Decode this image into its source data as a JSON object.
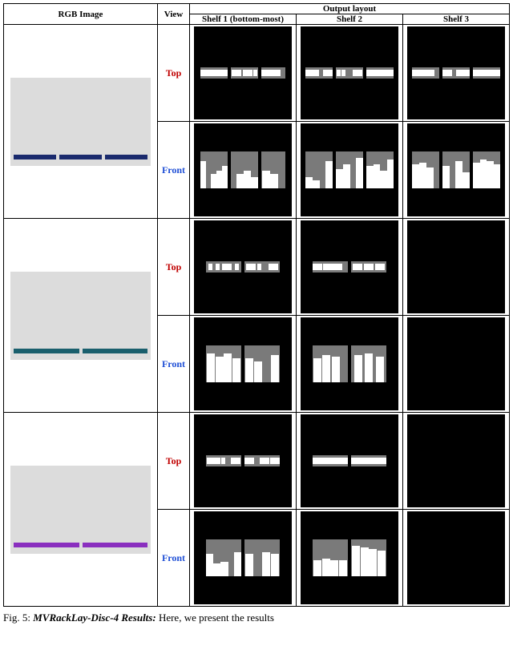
{
  "header": {
    "rgb": "RGB Image",
    "view": "View",
    "outputs_group": "Output layout",
    "shelf1": "Shelf 1 (bottom-most)",
    "shelf2": "Shelf 2",
    "shelf3": "Shelf 3"
  },
  "views": {
    "top": "Top",
    "front": "Front"
  },
  "caption_prefix": "Fig. 5:",
  "caption_title": "MVRackLay-Disc-4 Results:",
  "caption_rest": "Here, we present the results",
  "rows": [
    {
      "rgb": {
        "racks": 3,
        "tiers": 4,
        "color": "navy"
      },
      "shelves": {
        "1": {
          "top": {
            "bays": [
              {
                "w": 34,
                "items": [
                  "s",
                  "s",
                  "w",
                  "w"
                ]
              },
              {
                "w": 34,
                "items": [
                  "w",
                  "w",
                  "s"
                ]
              },
              {
                "w": 30,
                "items": [
                  "w",
                  "w",
                  "sp"
                ]
              }
            ]
          },
          "front": {
            "bays": [
              {
                "w": 34,
                "items": [
                  {
                    "h": 34
                  },
                  {
                    "sp": 1
                  },
                  {
                    "h": 18
                  },
                  {
                    "h": 22
                  },
                  {
                    "h": 28
                  }
                ]
              },
              {
                "w": 34,
                "items": [
                  {
                    "sp": 1
                  },
                  {
                    "h": 18
                  },
                  {
                    "h": 22
                  },
                  {
                    "h": 14
                  }
                ]
              },
              {
                "w": 30,
                "items": [
                  {
                    "h": 22
                  },
                  {
                    "h": 18
                  },
                  {
                    "sp": 1
                  }
                ]
              }
            ]
          }
        },
        "2": {
          "top": {
            "bays": [
              {
                "w": 34,
                "items": [
                  "w",
                  "s",
                  "sp",
                  "w"
                ]
              },
              {
                "w": 34,
                "items": [
                  "s",
                  "s",
                  "sp",
                  "w"
                ]
              },
              {
                "w": 34,
                "items": [
                  "w",
                  "w",
                  "s",
                  "w"
                ]
              }
            ]
          },
          "front": {
            "bays": [
              {
                "w": 34,
                "items": [
                  {
                    "h": 14
                  },
                  {
                    "h": 10
                  },
                  {
                    "sp": 1
                  },
                  {
                    "h": 34
                  }
                ]
              },
              {
                "w": 34,
                "items": [
                  {
                    "h": 24
                  },
                  {
                    "h": 30
                  },
                  {
                    "sp": 1
                  },
                  {
                    "h": 38
                  }
                ]
              },
              {
                "w": 34,
                "items": [
                  {
                    "h": 28
                  },
                  {
                    "h": 30
                  },
                  {
                    "h": 22
                  },
                  {
                    "h": 36
                  }
                ]
              }
            ]
          }
        },
        "3": {
          "top": {
            "bays": [
              {
                "w": 34,
                "items": [
                  "w",
                  "w",
                  "s",
                  "sp"
                ]
              },
              {
                "w": 34,
                "items": [
                  "w",
                  "sp",
                  "w",
                  "s"
                ]
              },
              {
                "w": 34,
                "items": [
                  "w",
                  "w",
                  "w",
                  "w"
                ]
              }
            ]
          },
          "front": {
            "bays": [
              {
                "w": 34,
                "items": [
                  {
                    "h": 30
                  },
                  {
                    "h": 32
                  },
                  {
                    "h": 26
                  },
                  {
                    "sp": 1
                  }
                ]
              },
              {
                "w": 34,
                "items": [
                  {
                    "h": 28
                  },
                  {
                    "sp": 1
                  },
                  {
                    "h": 34
                  },
                  {
                    "h": 20
                  }
                ]
              },
              {
                "w": 34,
                "items": [
                  {
                    "h": 32
                  },
                  {
                    "h": 36
                  },
                  {
                    "h": 34
                  },
                  {
                    "h": 30
                  }
                ]
              }
            ]
          }
        }
      }
    },
    {
      "rgb": {
        "racks": 2,
        "tiers": 3,
        "color": "teal"
      },
      "shelves": {
        "1": {
          "top": {
            "bays": [
              {
                "w": 44,
                "items": [
                  "s",
                  "s",
                  "w",
                  "s"
                ]
              },
              {
                "w": 44,
                "items": [
                  "w",
                  "s",
                  "sp",
                  "w"
                ]
              }
            ]
          },
          "front": {
            "bays": [
              {
                "w": 44,
                "items": [
                  {
                    "h": 36
                  },
                  {
                    "h": 32
                  },
                  {
                    "h": 36
                  },
                  {
                    "h": 30
                  }
                ]
              },
              {
                "w": 44,
                "items": [
                  {
                    "h": 30
                  },
                  {
                    "h": 26
                  },
                  {
                    "sp": 1
                  },
                  {
                    "h": 34
                  }
                ]
              }
            ]
          }
        },
        "2": {
          "top": {
            "bays": [
              {
                "w": 44,
                "items": [
                  "w",
                  "w",
                  "w",
                  "sp"
                ]
              },
              {
                "w": 44,
                "items": [
                  "w",
                  "w",
                  "w"
                ]
              }
            ]
          },
          "front": {
            "bays": [
              {
                "w": 44,
                "items": [
                  {
                    "h": 30
                  },
                  {
                    "h": 34
                  },
                  {
                    "h": 32
                  },
                  {
                    "sp": 1
                  }
                ]
              },
              {
                "w": 44,
                "items": [
                  {
                    "h": 34
                  },
                  {
                    "h": 36
                  },
                  {
                    "h": 32
                  }
                ]
              }
            ]
          }
        },
        "3": {
          "top": null,
          "front": null
        }
      }
    },
    {
      "rgb": {
        "racks": 2,
        "tiers": 3,
        "color": "purple"
      },
      "shelves": {
        "1": {
          "top": {
            "bays": [
              {
                "w": 44,
                "items": [
                  "w",
                  "s",
                  "s",
                  "sp",
                  "w"
                ]
              },
              {
                "w": 44,
                "items": [
                  "w",
                  "sp",
                  "w",
                  "w"
                ]
              }
            ]
          },
          "front": {
            "bays": [
              {
                "w": 44,
                "items": [
                  {
                    "h": 28
                  },
                  {
                    "h": 16
                  },
                  {
                    "h": 18
                  },
                  {
                    "sp": 1
                  },
                  {
                    "h": 30
                  }
                ]
              },
              {
                "w": 44,
                "items": [
                  {
                    "h": 28
                  },
                  {
                    "sp": 1
                  },
                  {
                    "h": 30
                  },
                  {
                    "h": 28
                  }
                ]
              }
            ]
          }
        },
        "2": {
          "top": {
            "bays": [
              {
                "w": 44,
                "items": [
                  "w",
                  "w",
                  "w",
                  "w"
                ]
              },
              {
                "w": 44,
                "items": [
                  "w",
                  "w",
                  "w",
                  "w"
                ]
              }
            ]
          },
          "front": {
            "bays": [
              {
                "w": 44,
                "items": [
                  {
                    "h": 20
                  },
                  {
                    "h": 22
                  },
                  {
                    "h": 20
                  },
                  {
                    "h": 20
                  }
                ]
              },
              {
                "w": 44,
                "items": [
                  {
                    "h": 38
                  },
                  {
                    "h": 36
                  },
                  {
                    "h": 34
                  },
                  {
                    "h": 32
                  }
                ]
              }
            ]
          }
        },
        "3": {
          "top": null,
          "front": null
        }
      }
    }
  ]
}
